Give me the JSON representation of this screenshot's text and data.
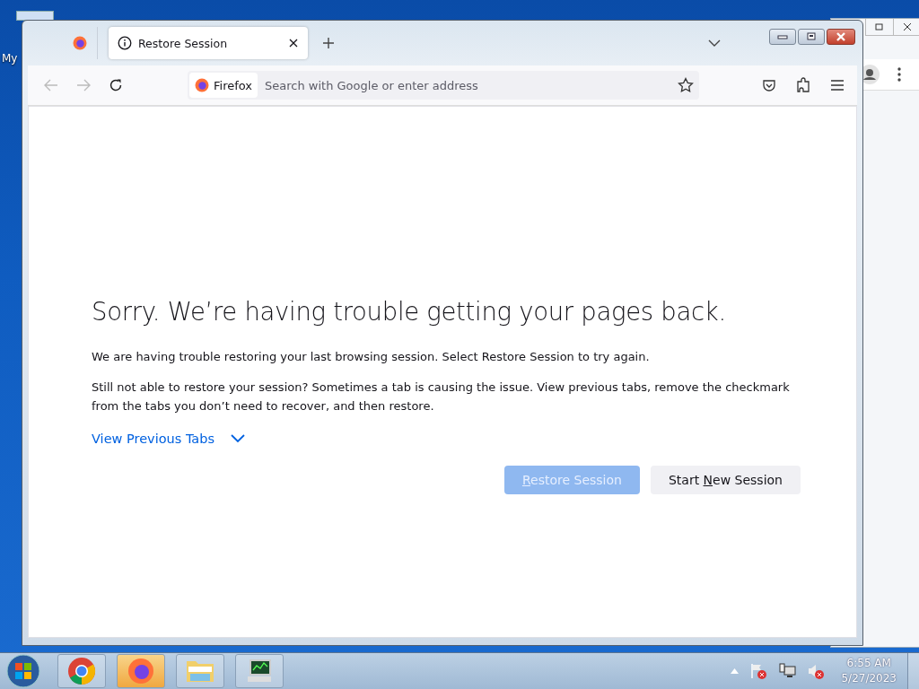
{
  "desktop": {
    "icon_label": "My"
  },
  "browser": {
    "tabs": [
      {
        "kind": "pinned",
        "selected": false
      },
      {
        "kind": "page",
        "label": "Restore Session",
        "selected": true
      }
    ],
    "address": {
      "identity": "Firefox",
      "placeholder": "Search with Google or enter address"
    },
    "nav": {
      "back_disabled": true,
      "forward_disabled": true
    }
  },
  "page": {
    "heading": "Sorry. We’re having trouble getting your pages back.",
    "paragraphs": [
      "We are having trouble restoring your last browsing session. Select Restore Session to try again.",
      "Still not able to restore your session? Sometimes a tab is causing the issue. View previous tabs, remove the checkmark from the tabs you don’t need to recover, and then restore."
    ],
    "toggle": {
      "label": "View Previous Tabs",
      "expanded": false
    },
    "buttons": [
      {
        "key": "R",
        "after": "estore Session",
        "disabled": true,
        "kind": "primary"
      },
      {
        "before": "Start ",
        "key": "N",
        "after": "ew Session",
        "disabled": false,
        "kind": "secondary"
      }
    ]
  },
  "taskbar": {
    "apps": [
      {
        "kind": "chrome",
        "selected": false
      },
      {
        "kind": "firefox",
        "selected": true
      },
      {
        "kind": "explorer",
        "selected": false
      },
      {
        "kind": "monitor",
        "selected": false
      }
    ],
    "time": "6:55 AM",
    "date": "5/27/2023"
  }
}
